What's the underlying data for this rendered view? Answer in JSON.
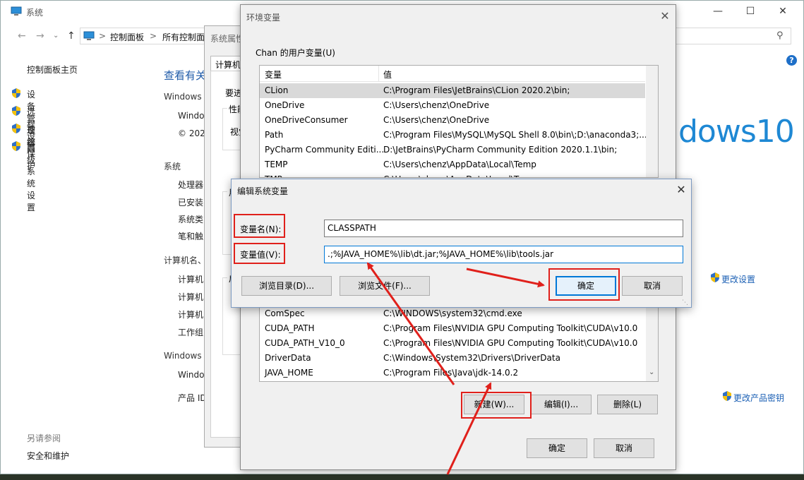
{
  "system_window": {
    "title": "系统",
    "breadcrumbs": [
      "控制面板",
      "所有控制面"
    ],
    "left_nav": {
      "home": "控制面板主页",
      "items": [
        "设备管理器",
        "远程设置",
        "系统保护",
        "高级系统设置"
      ],
      "see_also_header": "另请参阅",
      "see_also_item": "安全和维护"
    },
    "main": {
      "heading": "查看有关",
      "windows_edition_header": "Windows",
      "edition_rows": [
        "Windo",
        "© 202"
      ],
      "system_header": "系统",
      "system_rows": [
        "处理器:",
        "已安装",
        "系统类",
        "笔和触"
      ],
      "computer_header": "计算机名、",
      "computer_rows": [
        "计算机",
        "计算机",
        "计算机",
        "工作组"
      ],
      "activation_header": "Windows",
      "activation_rows": [
        "Windo",
        "产品 ID"
      ],
      "win10_logo": "dows10",
      "change_settings": "更改设置",
      "change_product_key": "更改产品密钥"
    }
  },
  "system_properties": {
    "title": "系统属性",
    "tab": "计算机",
    "text1": "要进",
    "group1": "性能",
    "group1_text": "视觉",
    "group2": "用",
    "group3": "启"
  },
  "env_dialog": {
    "title": "环境变量",
    "user_vars_label": "Chan 的用户变量(U)",
    "columns": [
      "变量",
      "值"
    ],
    "user_vars": [
      {
        "name": "CLion",
        "value": "C:\\Program Files\\JetBrains\\CLion 2020.2\\bin;"
      },
      {
        "name": "OneDrive",
        "value": "C:\\Users\\chenz\\OneDrive"
      },
      {
        "name": "OneDriveConsumer",
        "value": "C:\\Users\\chenz\\OneDrive"
      },
      {
        "name": "Path",
        "value": "C:\\Program Files\\MySQL\\MySQL Shell 8.0\\bin\\;D:\\anaconda3;..."
      },
      {
        "name": "PyCharm Community Editi...",
        "value": "D:\\JetBrains\\PyCharm Community Edition 2020.1.1\\bin;"
      },
      {
        "name": "TEMP",
        "value": "C:\\Users\\chenz\\AppData\\Local\\Temp"
      },
      {
        "name": "TMP",
        "value": "C:\\Users\\chenz\\AppData\\Local\\Temp"
      }
    ],
    "system_vars": [
      {
        "name": "ComSpec",
        "value": "C:\\WINDOWS\\system32\\cmd.exe"
      },
      {
        "name": "CUDA_PATH",
        "value": "C:\\Program Files\\NVIDIA GPU Computing Toolkit\\CUDA\\v10.0"
      },
      {
        "name": "CUDA_PATH_V10_0",
        "value": "C:\\Program Files\\NVIDIA GPU Computing Toolkit\\CUDA\\v10.0"
      },
      {
        "name": "DriverData",
        "value": "C:\\Windows\\System32\\Drivers\\DriverData"
      },
      {
        "name": "JAVA_HOME",
        "value": "C:\\Program Files\\Java\\jdk-14.0.2"
      }
    ],
    "buttons": {
      "new": "新建(W)...",
      "edit": "编辑(I)...",
      "delete": "删除(L)",
      "ok": "确定",
      "cancel": "取消"
    }
  },
  "edit_dialog": {
    "title": "编辑系统变量",
    "name_label": "变量名(N):",
    "value_label": "变量值(V):",
    "name_value": "CLASSPATH",
    "value_value": ".;%JAVA_HOME%\\lib\\dt.jar;%JAVA_HOME%\\lib\\tools.jar",
    "buttons": {
      "browse_dir": "浏览目录(D)...",
      "browse_file": "浏览文件(F)...",
      "ok": "确定",
      "cancel": "取消"
    }
  },
  "icons": [
    "monitor-icon",
    "shield-icon",
    "search-icon",
    "help-icon",
    "close-icon",
    "minimize-icon",
    "maximize-icon",
    "back-icon",
    "forward-icon",
    "up-icon"
  ],
  "colors": {
    "accent": "#0078d7",
    "annotation": "#e0201b",
    "win10_blue": "#1e88d4",
    "link": "#1a5fb4"
  }
}
